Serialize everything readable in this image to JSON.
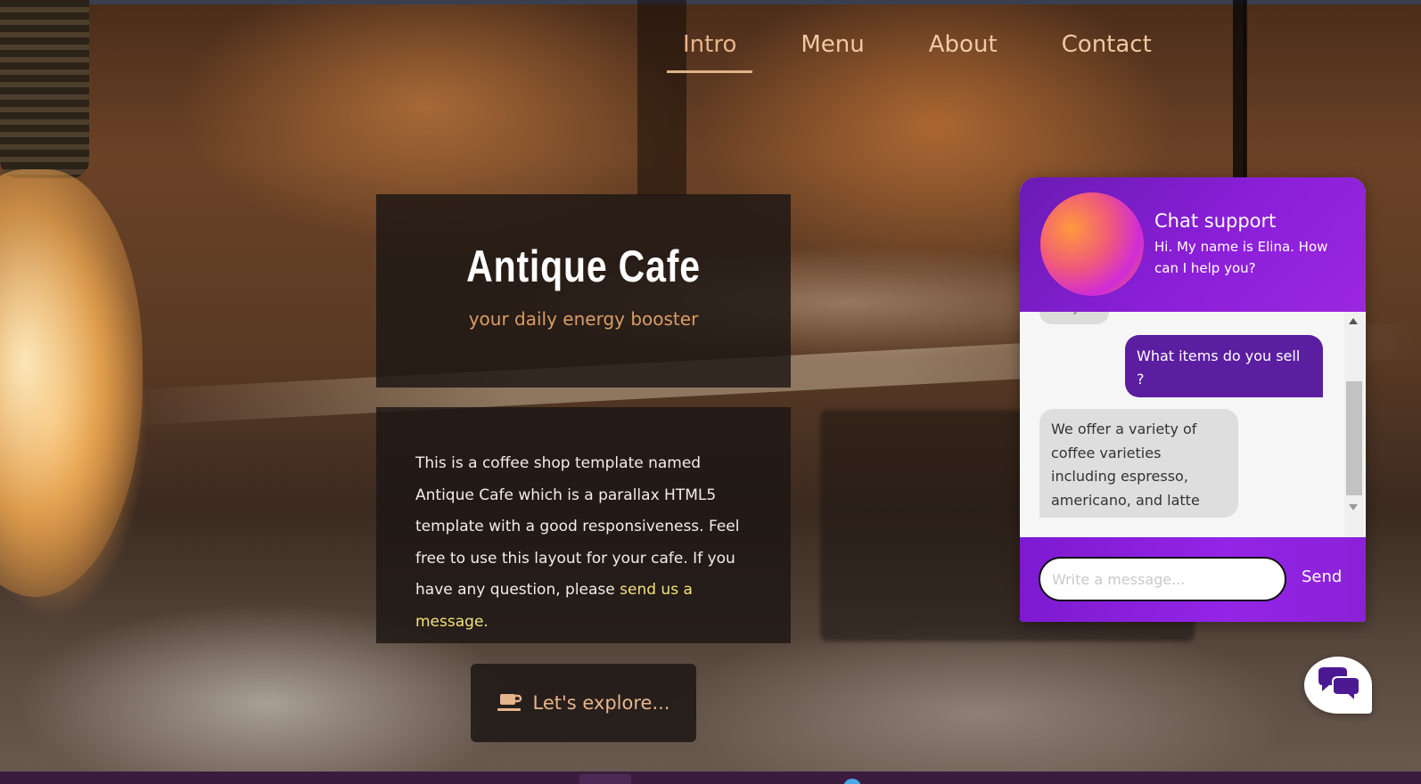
{
  "nav": {
    "items": [
      {
        "label": "Intro",
        "active": true
      },
      {
        "label": "Menu",
        "active": false
      },
      {
        "label": "About",
        "active": false
      },
      {
        "label": "Contact",
        "active": false
      }
    ]
  },
  "hero": {
    "title": "Antique Cafe",
    "subtitle": "your daily energy booster",
    "description": "This is a coffee shop template named Antique Cafe which is a parallax HTML5 template with a good responsiveness. Feel free to use this layout for your cafe. If you have any question, please ",
    "description_link": "send us a message.",
    "explore_label": "Let's explore...",
    "explore_icon": "coffee-cup-icon"
  },
  "chat": {
    "title": "Chat support",
    "greeting": "Hi. My name is Elina. How can I help you?",
    "partial_message": "ay",
    "messages": [
      {
        "from": "user",
        "text": "What items do you sell ?"
      },
      {
        "from": "agent",
        "text": "We offer a variety of coffee varieties including espresso, americano, and latte"
      }
    ],
    "input_placeholder": "Write a message...",
    "send_label": "Send",
    "launcher_icon": "chat-bubbles-icon"
  },
  "colors": {
    "accent": "#e8b48a",
    "link": "#f3e27a",
    "chat_purple": "#8b1fd8",
    "user_bubble": "#5b1ea0"
  }
}
